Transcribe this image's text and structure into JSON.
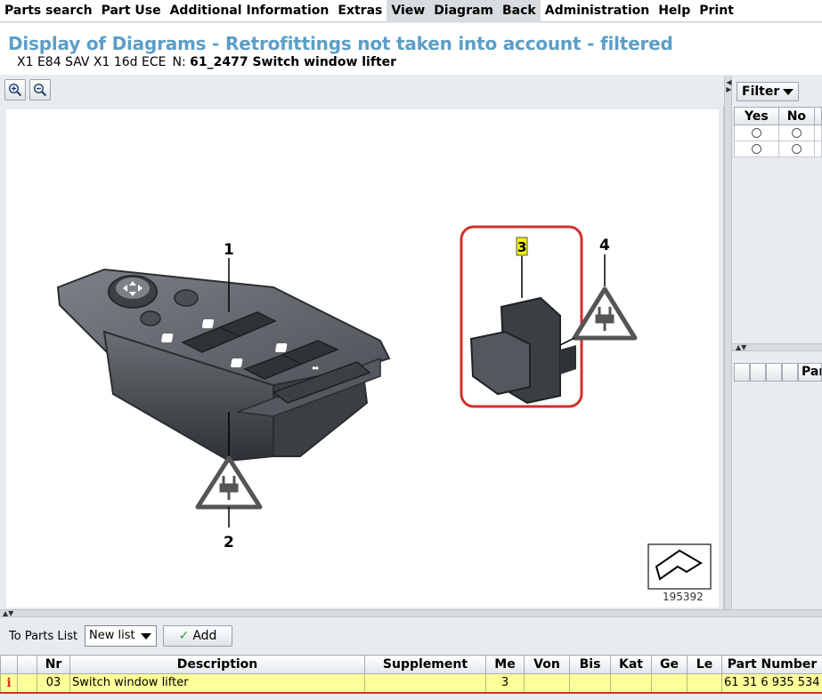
{
  "menu": [
    "Parts search",
    "Part Use",
    "Additional Information",
    "Extras",
    "View",
    "Diagram",
    "Back",
    "Administration",
    "Help",
    "Print"
  ],
  "title": "Display of Diagrams - Retrofittings not taken into account - filtered",
  "vehicle": {
    "model": "X1 E84 SAV X1 16d ECE",
    "n_label": "N:",
    "diagram": "61_2477 Switch window lifter"
  },
  "diagram": {
    "callouts": [
      "1",
      "2",
      "3",
      "4"
    ],
    "selected_callout": "3",
    "image_number": "195392"
  },
  "filter": {
    "button_label": "Filter",
    "columns": [
      "Yes",
      "No"
    ],
    "rows": 2
  },
  "right_lower_header": "Part",
  "parts_controls": {
    "to_parts_label": "To Parts List",
    "list_value": "New list",
    "add_label": "Add"
  },
  "parts_table": {
    "headers": [
      "",
      "",
      "Nr",
      "Description",
      "Supplement",
      "Me",
      "Von",
      "Bis",
      "Kat",
      "Ge",
      "Le",
      "Part Number"
    ],
    "rows": [
      {
        "info": "i",
        "flag": "",
        "nr": "03",
        "description": "Switch window lifter",
        "supplement": "",
        "me": "3",
        "von": "",
        "bis": "",
        "kat": "",
        "ge": "",
        "le": "",
        "part_number": "61 31 6 935 534"
      }
    ]
  },
  "colors": {
    "title": "#5b9ec8",
    "selected_row": "#ffff99",
    "highlight_box": "#d0302a",
    "callout_highlight": "#f4f000"
  }
}
